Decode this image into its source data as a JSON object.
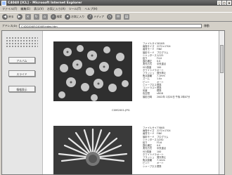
{
  "window": {
    "title": "C4040 [ICL] - Microsoft Internet Explorer",
    "controls": [
      "_",
      "□",
      "×"
    ]
  },
  "menu": [
    "ファイル(F)",
    "編集(E)",
    "表示(V)",
    "お気に入り(A)",
    "ツール(T)",
    "ヘルプ(H)"
  ],
  "toolbar": {
    "back": "戻る",
    "search": "検索",
    "favorites": "お気に入り",
    "media": "メディア"
  },
  "address": {
    "label": "アドレス(D)",
    "value": "C:\\DC4040\\C4040\\index.htm",
    "go": "移動"
  },
  "sidebar": {
    "buttons": [
      "アルバム",
      "スライド",
      "情報表示"
    ]
  },
  "photos": [
    {
      "caption": "C0M2001.JPG",
      "info": [
        [
          "ファイルサイズ",
          "581KB"
        ],
        [
          "画像サイズ",
          "2272×1704"
        ],
        [
          "画質モード",
          "FINE"
        ],
        [
          "撮影モード",
          "プログラム"
        ],
        [
          "シャッタースピード",
          "1/125"
        ],
        [
          "絞り",
          "F4.0"
        ],
        [
          "露出補正",
          "0.0"
        ],
        [
          "測光方式",
          "中央重点"
        ],
        [
          "ISO感度",
          "100"
        ],
        [
          "ホワイトバランス",
          "オート"
        ],
        [
          "フラッシュ",
          "発光禁止"
        ],
        [
          "焦点距離",
          "7.1mm"
        ],
        [
          "ズーム",
          "1.0x"
        ],
        [
          "ピント",
          "オート"
        ],
        [
          "シャープネス",
          "標準"
        ],
        [
          "コントラスト",
          "標準"
        ],
        [
          "彩度",
          "標準"
        ],
        [
          "色空間",
          "sRGB"
        ],
        [
          "撮影日時",
          "2002年 1月20日 午後 2時07分"
        ]
      ]
    },
    {
      "caption": "",
      "info": [
        [
          "ファイルサイズ",
          "776KB"
        ],
        [
          "画像サイズ",
          "2272×1704"
        ],
        [
          "画質モード",
          "FINE"
        ],
        [
          "撮影モード",
          "プログラム"
        ],
        [
          "シャッタースピード",
          "1/250"
        ],
        [
          "絞り",
          "F5.6"
        ],
        [
          "露出補正",
          "0.0"
        ],
        [
          "測光方式",
          "中央重点"
        ],
        [
          "ISO感度",
          "100"
        ],
        [
          "ホワイトバランス",
          "オート"
        ],
        [
          "フラッシュ",
          "発光禁止"
        ],
        [
          "焦点距離",
          "7.1mm"
        ],
        [
          "ピント",
          "オート"
        ],
        [
          "シャープネス",
          "標準"
        ]
      ]
    }
  ]
}
